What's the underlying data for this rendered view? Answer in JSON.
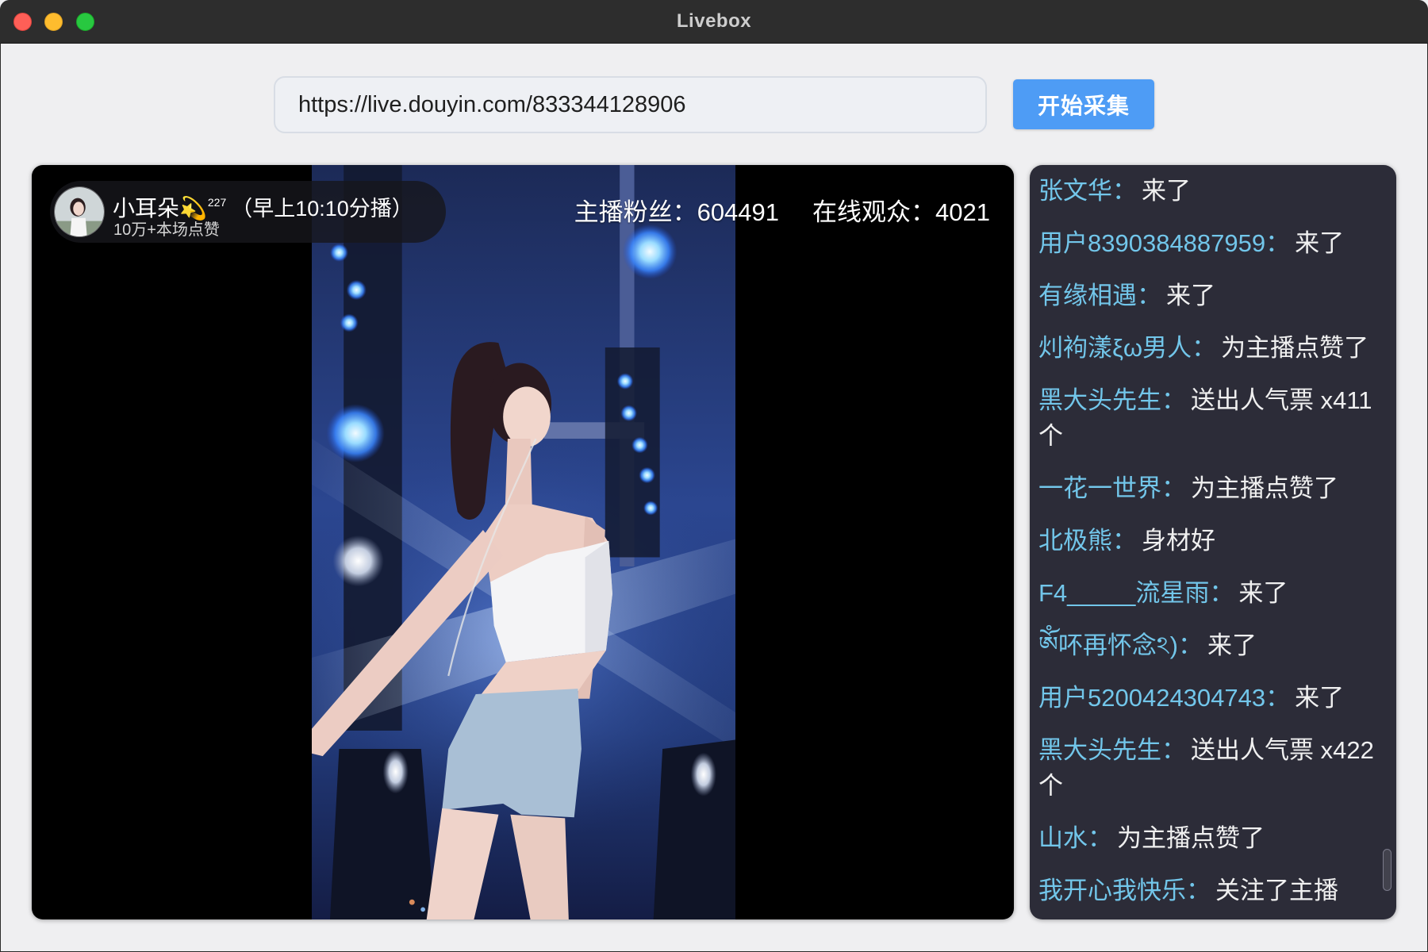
{
  "window": {
    "title": "Livebox"
  },
  "toolbar": {
    "url_value": "https://live.douyin.com/833344128906",
    "start_button_label": "开始采集"
  },
  "stream": {
    "streamer_name": "小耳朵💫",
    "fan_level": "227",
    "schedule": "（早上10:10分播）",
    "likes": "10万+本场点赞",
    "fans_label": "主播粉丝：",
    "fans_value": "604491",
    "viewers_label": "在线观众：",
    "viewers_value": "4021"
  },
  "chat": {
    "messages": [
      {
        "name": "张文华：",
        "text": "来了"
      },
      {
        "name": "用户8390384887959：",
        "text": "来了"
      },
      {
        "name": "有缘相遇：",
        "text": "来了"
      },
      {
        "name": "灲袧漾ξω男人：",
        "text": "为主播点赞了"
      },
      {
        "name": "黑大头先生：",
        "text": "送出人气票 x411 个"
      },
      {
        "name": "一花一世界：",
        "text": "为主播点赞了"
      },
      {
        "name": "北极熊：",
        "text": "身材好"
      },
      {
        "name": "F4_____流星雨：",
        "text": "来了"
      },
      {
        "name": "ༀ吥再怀念ঽ)：",
        "text": "来了"
      },
      {
        "name": "用户5200424304743：",
        "text": "来了"
      },
      {
        "name": "黑大头先生：",
        "text": "送出人气票 x422 个"
      },
      {
        "name": "山水：",
        "text": "为主播点赞了"
      },
      {
        "name": "我开心我快乐：",
        "text": "关注了主播"
      }
    ]
  },
  "colors": {
    "titlebar": "#2d2d2d",
    "window_bg": "#efeff1",
    "accent_button": "#4e9cf5",
    "chat_bg": "#2c2c38",
    "chat_name": "#72c6ea",
    "chat_text": "#f0f0f0",
    "traffic_close": "#fe5f57",
    "traffic_minimize": "#febc2e",
    "traffic_zoom": "#28c840"
  }
}
